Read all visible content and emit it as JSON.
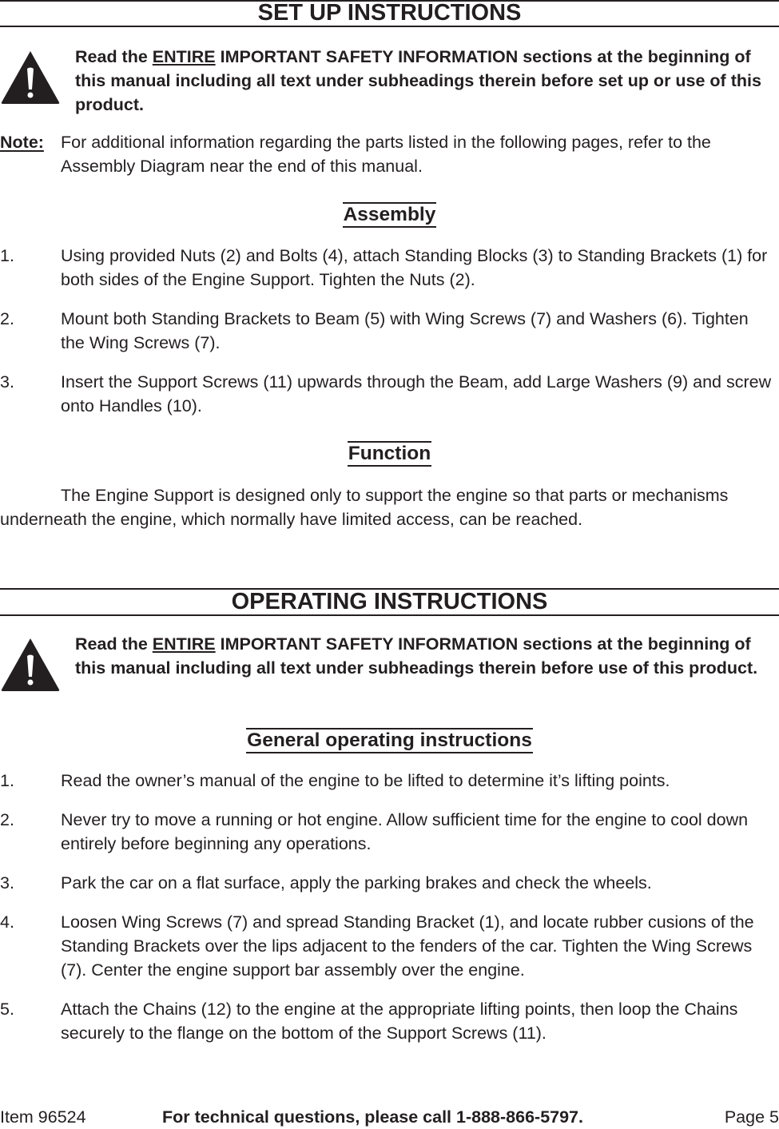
{
  "setup": {
    "title": "SET UP INSTRUCTIONS",
    "warning": {
      "icon": "warning-triangle-icon",
      "prefix": "Read the ",
      "emphasis": "ENTIRE",
      "suffix": " IMPORTANT SAFETY INFORMATION sections at the beginning of this manual including all text under subheadings therein before set up or use of this product."
    },
    "note": {
      "label": "Note:",
      "text": "For additional information regarding the parts listed in the following pages, refer to the Assembly Diagram near the end of this manual."
    },
    "assembly": {
      "heading": "Assembly",
      "steps": [
        {
          "num": "1.",
          "text": "Using provided Nuts (2) and Bolts (4), attach Standing Blocks (3) to Standing Brackets (1) for both sides of the Engine Support.  Tighten the Nuts (2)."
        },
        {
          "num": "2.",
          "text": "Mount both Standing Brackets to Beam (5) with Wing Screws (7) and Washers (6).  Tighten the Wing Screws (7)."
        },
        {
          "num": "3.",
          "text": "Insert the Support Screws (11) upwards through the Beam, add Large Washers (9) and screw onto Handles (10)."
        }
      ]
    },
    "function": {
      "heading": "Function",
      "text": "The Engine Support is designed only to support the engine so that parts or mechanisms underneath the engine, which normally have limited access, can be reached."
    }
  },
  "operating": {
    "title": "OPERATING INSTRUCTIONS",
    "warning": {
      "icon": "warning-triangle-icon",
      "prefix": "Read the ",
      "emphasis": "ENTIRE",
      "suffix": " IMPORTANT SAFETY INFORMATION sections at the beginning of this manual including all text under subheadings therein before use of this product."
    },
    "general": {
      "heading": "General operating instructions",
      "steps": [
        {
          "num": "1.",
          "text": "Read the owner’s manual of the engine to be lifted to determine it’s lifting points."
        },
        {
          "num": "2.",
          "text": "Never try to move a running or hot engine.  Allow sufficient time for the engine to cool down entirely before beginning any operations."
        },
        {
          "num": "3.",
          "text": "Park the car on a flat surface, apply the parking brakes and check the wheels."
        },
        {
          "num": "4.",
          "text": "Loosen Wing Screws (7) and spread Standing Bracket (1), and locate rubber cusions of the Standing Brackets over the lips adjacent to the fenders of the car.  Tighten the Wing Screws (7).  Center the engine support bar assembly over the engine."
        },
        {
          "num": "5.",
          "text": "Attach the Chains (12) to the engine at the appropriate lifting points, then loop the Chains securely to the flange on the bottom of the Support Screws (11)."
        }
      ]
    }
  },
  "footer": {
    "item": "Item 96524",
    "support": "For technical questions, please call 1-888-866-5797.",
    "page": "Page 5"
  }
}
